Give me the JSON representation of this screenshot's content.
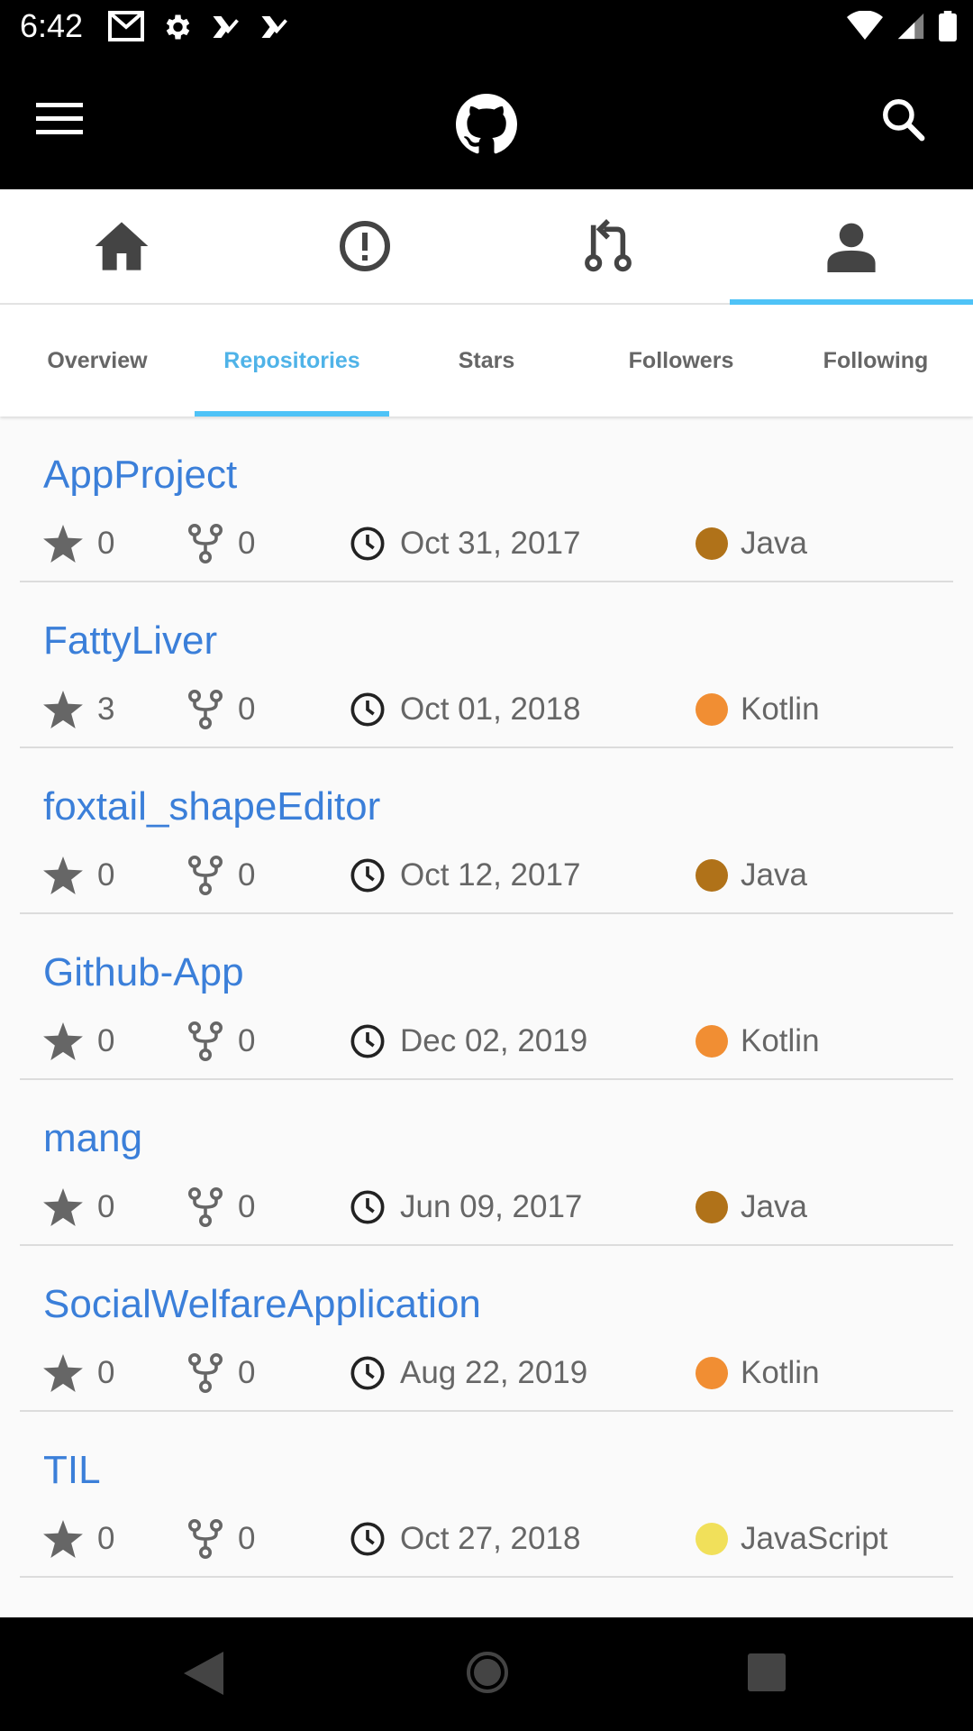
{
  "status_bar": {
    "time": "6:42",
    "left_icons": [
      "gmail-icon",
      "settings-icon",
      "task-icon",
      "task-icon"
    ],
    "right_icons": [
      "wifi-icon",
      "signal-icon",
      "battery-icon"
    ]
  },
  "app_bar": {
    "menu_icon": "hamburger-menu-icon",
    "logo_icon": "github-octocat-icon",
    "search_icon": "search-icon"
  },
  "main_tabs": [
    {
      "icon": "home-icon"
    },
    {
      "icon": "issues-icon"
    },
    {
      "icon": "pull-request-icon"
    },
    {
      "icon": "profile-icon",
      "active": true
    }
  ],
  "sub_tabs": [
    {
      "label": "Overview"
    },
    {
      "label": "Repositories",
      "active": true
    },
    {
      "label": "Stars"
    },
    {
      "label": "Followers"
    },
    {
      "label": "Following"
    }
  ],
  "repos": [
    {
      "name": "AppProject",
      "stars": "0",
      "forks": "0",
      "date": "Oct 31, 2017",
      "language": "Java",
      "lang_color": "#b07219"
    },
    {
      "name": "FattyLiver",
      "stars": "3",
      "forks": "0",
      "date": "Oct 01, 2018",
      "language": "Kotlin",
      "lang_color": "#f18e33"
    },
    {
      "name": "foxtail_shapeEditor",
      "stars": "0",
      "forks": "0",
      "date": "Oct 12, 2017",
      "language": "Java",
      "lang_color": "#b07219"
    },
    {
      "name": "Github-App",
      "stars": "0",
      "forks": "0",
      "date": "Dec 02, 2019",
      "language": "Kotlin",
      "lang_color": "#f18e33"
    },
    {
      "name": "mang",
      "stars": "0",
      "forks": "0",
      "date": "Jun 09, 2017",
      "language": "Java",
      "lang_color": "#b07219"
    },
    {
      "name": "SocialWelfareApplication",
      "stars": "0",
      "forks": "0",
      "date": "Aug 22, 2019",
      "language": "Kotlin",
      "lang_color": "#f18e33"
    },
    {
      "name": "TIL",
      "stars": "0",
      "forks": "0",
      "date": "Oct 27, 2018",
      "language": "JavaScript",
      "lang_color": "#f1e05a"
    }
  ],
  "colors": {
    "accent": "#4fc3f7",
    "link": "#3b7fd9"
  }
}
